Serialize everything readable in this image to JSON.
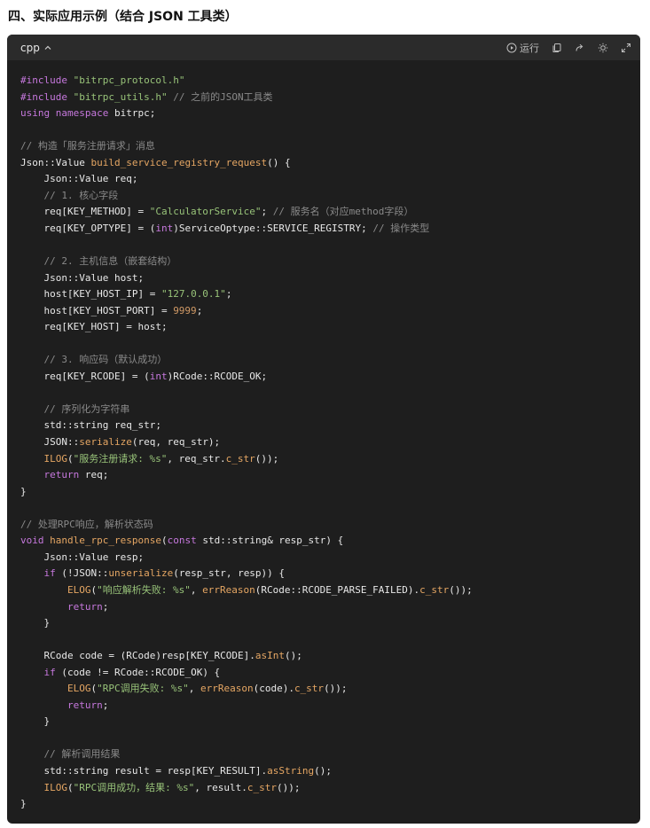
{
  "heading": "四、实际应用示例（结合 JSON 工具类）",
  "code_block": {
    "language": "cpp",
    "run_label": "运行",
    "icons": [
      "chevron-up-icon",
      "run-icon",
      "copy-icon",
      "share-icon",
      "theme-icon",
      "expand-icon"
    ],
    "colors": {
      "background": "#1e1e1e",
      "header": "#2b2b2b",
      "keyword": "#c678dd",
      "string": "#98c379",
      "number": "#d19a66",
      "function": "#e5a663",
      "comment": "#8a8a8a",
      "text": "#e8e8e8"
    },
    "lines": [
      [
        [
          "kw",
          "#include "
        ],
        [
          "str",
          "\"bitrpc_protocol.h\""
        ]
      ],
      [
        [
          "kw",
          "#include "
        ],
        [
          "str",
          "\"bitrpc_utils.h\""
        ],
        [
          "p",
          " "
        ],
        [
          "cm",
          "// 之前的JSON工具类"
        ]
      ],
      [
        [
          "kw",
          "using"
        ],
        [
          "p",
          " "
        ],
        [
          "kw",
          "namespace"
        ],
        [
          "p",
          " bitrpc;"
        ]
      ],
      [],
      [
        [
          "cm",
          "// 构造「服务注册请求」消息"
        ]
      ],
      [
        [
          "p",
          "Json::Value "
        ],
        [
          "fn",
          "build_service_registry_request"
        ],
        [
          "p",
          "() {"
        ]
      ],
      [
        [
          "p",
          "    Json::Value req;"
        ]
      ],
      [
        [
          "cm",
          "    // 1. 核心字段"
        ]
      ],
      [
        [
          "p",
          "    req[KEY_METHOD] = "
        ],
        [
          "str",
          "\"CalculatorService\""
        ],
        [
          "p",
          "; "
        ],
        [
          "cm",
          "// 服务名（对应method字段）"
        ]
      ],
      [
        [
          "p",
          "    req[KEY_OPTYPE] = ("
        ],
        [
          "kw",
          "int"
        ],
        [
          "p",
          ")ServiceOptype::SERVICE_REGISTRY; "
        ],
        [
          "cm",
          "// 操作类型"
        ]
      ],
      [],
      [
        [
          "cm",
          "    // 2. 主机信息（嵌套结构）"
        ]
      ],
      [
        [
          "p",
          "    Json::Value host;"
        ]
      ],
      [
        [
          "p",
          "    host[KEY_HOST_IP] = "
        ],
        [
          "str",
          "\"127.0.0.1\""
        ],
        [
          "p",
          ";"
        ]
      ],
      [
        [
          "p",
          "    host[KEY_HOST_PORT] = "
        ],
        [
          "num",
          "9999"
        ],
        [
          "p",
          ";"
        ]
      ],
      [
        [
          "p",
          "    req[KEY_HOST] = host;"
        ]
      ],
      [],
      [
        [
          "cm",
          "    // 3. 响应码（默认成功）"
        ]
      ],
      [
        [
          "p",
          "    req[KEY_RCODE] = ("
        ],
        [
          "kw",
          "int"
        ],
        [
          "p",
          ")RCode::RCODE_OK;"
        ]
      ],
      [],
      [
        [
          "cm",
          "    // 序列化为字符串"
        ]
      ],
      [
        [
          "p",
          "    std::string req_str;"
        ]
      ],
      [
        [
          "p",
          "    JSON::"
        ],
        [
          "fn",
          "serialize"
        ],
        [
          "p",
          "(req, req_str);"
        ]
      ],
      [
        [
          "p",
          "    "
        ],
        [
          "fn",
          "ILOG"
        ],
        [
          "p",
          "("
        ],
        [
          "str",
          "\"服务注册请求: %s\""
        ],
        [
          "p",
          ", req_str."
        ],
        [
          "fn",
          "c_str"
        ],
        [
          "p",
          "());"
        ]
      ],
      [
        [
          "p",
          "    "
        ],
        [
          "kw",
          "return"
        ],
        [
          "p",
          " req;"
        ]
      ],
      [
        [
          "p",
          "}"
        ]
      ],
      [],
      [
        [
          "cm",
          "// 处理RPC响应，解析状态码"
        ]
      ],
      [
        [
          "kw",
          "void"
        ],
        [
          "p",
          " "
        ],
        [
          "fn",
          "handle_rpc_response"
        ],
        [
          "p",
          "("
        ],
        [
          "kw",
          "const"
        ],
        [
          "p",
          " std::string& resp_str) {"
        ]
      ],
      [
        [
          "p",
          "    Json::Value resp;"
        ]
      ],
      [
        [
          "p",
          "    "
        ],
        [
          "kw",
          "if"
        ],
        [
          "p",
          " (!JSON::"
        ],
        [
          "fn",
          "unserialize"
        ],
        [
          "p",
          "(resp_str, resp)) {"
        ]
      ],
      [
        [
          "p",
          "        "
        ],
        [
          "fn",
          "ELOG"
        ],
        [
          "p",
          "("
        ],
        [
          "str",
          "\"响应解析失败: %s\""
        ],
        [
          "p",
          ", "
        ],
        [
          "fn",
          "errReason"
        ],
        [
          "p",
          "(RCode::RCODE_PARSE_FAILED)."
        ],
        [
          "fn",
          "c_str"
        ],
        [
          "p",
          "());"
        ]
      ],
      [
        [
          "p",
          "        "
        ],
        [
          "kw",
          "return"
        ],
        [
          "p",
          ";"
        ]
      ],
      [
        [
          "p",
          "    }"
        ]
      ],
      [],
      [
        [
          "p",
          "    RCode code = (RCode)resp[KEY_RCODE]."
        ],
        [
          "fn",
          "asInt"
        ],
        [
          "p",
          "();"
        ]
      ],
      [
        [
          "p",
          "    "
        ],
        [
          "kw",
          "if"
        ],
        [
          "p",
          " (code != RCode::RCODE_OK) {"
        ]
      ],
      [
        [
          "p",
          "        "
        ],
        [
          "fn",
          "ELOG"
        ],
        [
          "p",
          "("
        ],
        [
          "str",
          "\"RPC调用失败: %s\""
        ],
        [
          "p",
          ", "
        ],
        [
          "fn",
          "errReason"
        ],
        [
          "p",
          "(code)."
        ],
        [
          "fn",
          "c_str"
        ],
        [
          "p",
          "());"
        ]
      ],
      [
        [
          "p",
          "        "
        ],
        [
          "kw",
          "return"
        ],
        [
          "p",
          ";"
        ]
      ],
      [
        [
          "p",
          "    }"
        ]
      ],
      [],
      [
        [
          "cm",
          "    // 解析调用结果"
        ]
      ],
      [
        [
          "p",
          "    std::string result = resp[KEY_RESULT]."
        ],
        [
          "fn",
          "asString"
        ],
        [
          "p",
          "();"
        ]
      ],
      [
        [
          "p",
          "    "
        ],
        [
          "fn",
          "ILOG"
        ],
        [
          "p",
          "("
        ],
        [
          "str",
          "\"RPC调用成功，结果: %s\""
        ],
        [
          "p",
          ", result."
        ],
        [
          "fn",
          "c_str"
        ],
        [
          "p",
          "());"
        ]
      ],
      [
        [
          "p",
          "}"
        ]
      ]
    ]
  }
}
